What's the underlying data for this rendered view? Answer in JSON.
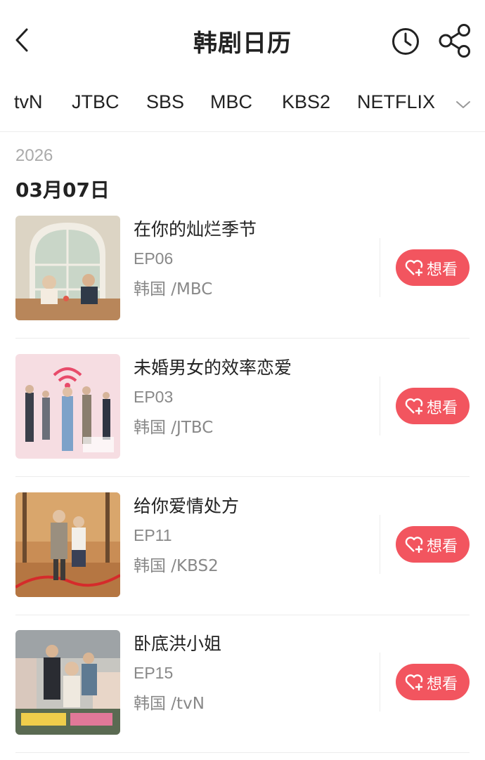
{
  "header": {
    "title": "韩剧日历",
    "back_icon": "chevron-left-icon",
    "history_icon": "clock-icon",
    "share_icon": "share-icon"
  },
  "tabs": [
    "tvN",
    "JTBC",
    "SBS",
    "MBC",
    "KBS2",
    "NETFLIX"
  ],
  "tabs_more_icon": "chevron-down-icon",
  "date": {
    "year": "2026",
    "day": "03月07日"
  },
  "items": [
    {
      "title": "在你的灿烂季节",
      "episode": "EP06",
      "meta": "韩国 /MBC",
      "button": "想看"
    },
    {
      "title": "未婚男女的效率恋爱",
      "episode": "EP03",
      "meta": "韩国 /JTBC",
      "button": "想看"
    },
    {
      "title": "给你爱情处方",
      "episode": "EP11",
      "meta": "韩国 /KBS2",
      "button": "想看"
    },
    {
      "title": "卧底洪小姐",
      "episode": "EP15",
      "meta": "韩国 /tvN",
      "button": "想看"
    }
  ],
  "colors": {
    "accent": "#f2555f",
    "muted": "#888888",
    "divider": "#ececec"
  }
}
